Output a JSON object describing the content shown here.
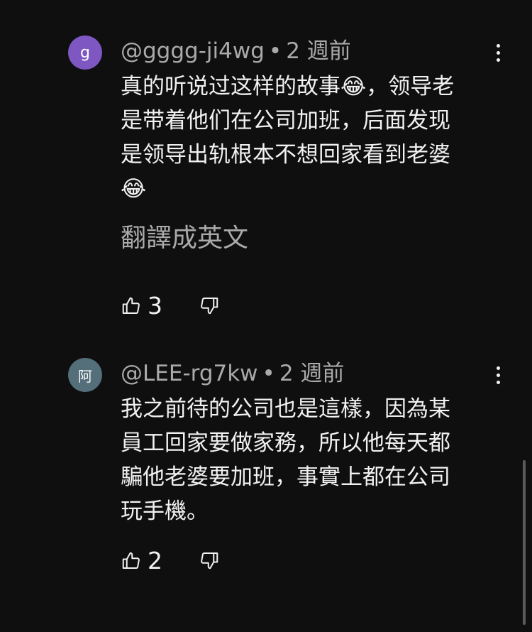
{
  "comments": [
    {
      "avatar_letter": "g",
      "avatar_color": "#7e57c2",
      "author": "@gggg-ji4wg",
      "separator": "•",
      "time": "2 週前",
      "lines": [
        "真的听说过这样的故事😂，领导老",
        "是带着他们在公司加班，后面发现",
        "是领导出轨根本不想回家看到老婆",
        "😂"
      ],
      "translate_label": "翻譯成英文",
      "likes": "3"
    },
    {
      "avatar_letter": "阿",
      "avatar_color": "#546e7a",
      "author": "@LEE-rg7kw",
      "separator": "•",
      "time": "2 週前",
      "lines": [
        "我之前待的公司也是這樣，因為某",
        "員工回家要做家務，所以他每天都",
        "騙他老婆要加班，事實上都在公司",
        "玩手機。"
      ],
      "likes": "2"
    }
  ],
  "icons": {
    "like": "thumbs-up-icon",
    "dislike": "thumbs-down-icon",
    "more": "more-vert-icon"
  }
}
